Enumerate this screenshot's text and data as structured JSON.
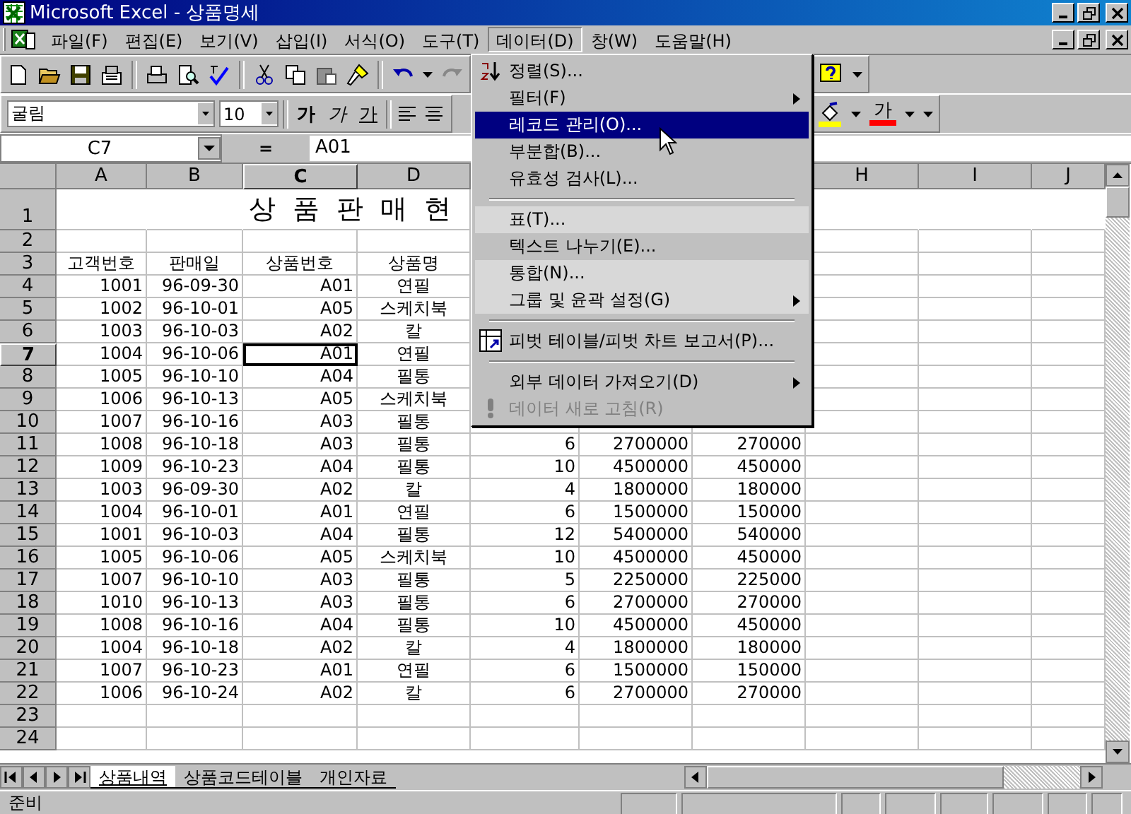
{
  "window": {
    "title": "Microsoft Excel - 상품명세"
  },
  "menu_bar": [
    {
      "label": "파일(F)",
      "selected": false
    },
    {
      "label": "편집(E)",
      "selected": false
    },
    {
      "label": "보기(V)",
      "selected": false
    },
    {
      "label": "삽입(I)",
      "selected": false
    },
    {
      "label": "서식(O)",
      "selected": false
    },
    {
      "label": "도구(T)",
      "selected": false
    },
    {
      "label": "데이터(D)",
      "selected": true
    },
    {
      "label": "창(W)",
      "selected": false
    },
    {
      "label": "도움말(H)",
      "selected": false
    }
  ],
  "formatting": {
    "font": "굴림",
    "size": "10",
    "bold": "가",
    "italic": "가",
    "underline": "가",
    "font_color": "가"
  },
  "formula_bar": {
    "name_box": "C7",
    "equals": "=",
    "content": "A01"
  },
  "data_menu": [
    {
      "kind": "sort",
      "label": "정렬(S)...",
      "submenu": false,
      "selected": false,
      "disabled": false,
      "rarely_used": false
    },
    {
      "kind": "item",
      "label": "필터(F)",
      "submenu": true,
      "selected": false,
      "disabled": false,
      "rarely_used": false
    },
    {
      "kind": "item",
      "label": "레코드 관리(O)...",
      "submenu": false,
      "selected": true,
      "disabled": false,
      "rarely_used": false
    },
    {
      "kind": "item",
      "label": "부분합(B)...",
      "submenu": false,
      "selected": false,
      "disabled": false,
      "rarely_used": false
    },
    {
      "kind": "item",
      "label": "유효성 검사(L)...",
      "submenu": false,
      "selected": false,
      "disabled": false,
      "rarely_used": false
    },
    {
      "kind": "separator"
    },
    {
      "kind": "item",
      "label": "표(T)...",
      "submenu": false,
      "selected": false,
      "disabled": false,
      "rarely_used": true
    },
    {
      "kind": "item",
      "label": "텍스트 나누기(E)...",
      "submenu": false,
      "selected": false,
      "disabled": false,
      "rarely_used": false
    },
    {
      "kind": "item",
      "label": "통합(N)...",
      "submenu": false,
      "selected": false,
      "disabled": false,
      "rarely_used": true
    },
    {
      "kind": "item",
      "label": "그룹 및 윤곽 설정(G)",
      "submenu": true,
      "selected": false,
      "disabled": false,
      "rarely_used": true
    },
    {
      "kind": "separator"
    },
    {
      "kind": "pivot",
      "label": "피벗 테이블/피벗 차트 보고서(P)...",
      "submenu": false,
      "selected": false,
      "disabled": false,
      "rarely_used": false
    },
    {
      "kind": "separator"
    },
    {
      "kind": "item",
      "label": "외부 데이터 가져오기(D)",
      "submenu": true,
      "selected": false,
      "disabled": false,
      "rarely_used": false
    },
    {
      "kind": "refresh",
      "label": "데이터 새로 고침(R)",
      "submenu": false,
      "selected": false,
      "disabled": true,
      "rarely_used": false
    }
  ],
  "sheet": {
    "columns": [
      {
        "label": "A",
        "selected": false
      },
      {
        "label": "B",
        "selected": false
      },
      {
        "label": "C",
        "selected": true
      },
      {
        "label": "D",
        "selected": false
      },
      null,
      null,
      null,
      {
        "label": "H",
        "selected": false
      },
      {
        "label": "I",
        "selected": false
      },
      {
        "label": "J",
        "selected": false
      }
    ],
    "rows": [
      {
        "header": "1",
        "kind": "title",
        "selected": false,
        "cells": [
          null,
          null,
          "상 품 판 매 현"
        ]
      },
      {
        "header": "2",
        "kind": "data",
        "selected": false,
        "cells": []
      },
      {
        "header": "3",
        "kind": "header",
        "selected": false,
        "cells": [
          "고객번호",
          "판매일",
          "상품번호",
          "상품명"
        ]
      },
      {
        "header": "4",
        "kind": "data",
        "selected": false,
        "cells": [
          "1001",
          "96-09-30",
          "A01",
          "연필"
        ]
      },
      {
        "header": "5",
        "kind": "data",
        "selected": false,
        "cells": [
          "1002",
          "96-10-01",
          "A05",
          "스케치북"
        ]
      },
      {
        "header": "6",
        "kind": "data",
        "selected": false,
        "cells": [
          "1003",
          "96-10-03",
          "A02",
          "칼"
        ]
      },
      {
        "header": "7",
        "kind": "data",
        "selected": true,
        "cells": [
          "1004",
          "96-10-06",
          "A01",
          "연필"
        ]
      },
      {
        "header": "8",
        "kind": "data",
        "selected": false,
        "cells": [
          "1005",
          "96-10-10",
          "A04",
          "필통"
        ]
      },
      {
        "header": "9",
        "kind": "data",
        "selected": false,
        "cells": [
          "1006",
          "96-10-13",
          "A05",
          "스케치북"
        ]
      },
      {
        "header": "10",
        "kind": "data",
        "selected": false,
        "cells": [
          "1007",
          "96-10-16",
          "A03",
          "필통"
        ]
      },
      {
        "header": "11",
        "kind": "data",
        "selected": false,
        "cells": [
          "1008",
          "96-10-18",
          "A03",
          "필통",
          "6",
          "2700000",
          "270000"
        ]
      },
      {
        "header": "12",
        "kind": "data",
        "selected": false,
        "cells": [
          "1009",
          "96-10-23",
          "A04",
          "필통",
          "10",
          "4500000",
          "450000"
        ]
      },
      {
        "header": "13",
        "kind": "data",
        "selected": false,
        "cells": [
          "1003",
          "96-09-30",
          "A02",
          "칼",
          "4",
          "1800000",
          "180000"
        ]
      },
      {
        "header": "14",
        "kind": "data",
        "selected": false,
        "cells": [
          "1004",
          "96-10-01",
          "A01",
          "연필",
          "6",
          "1500000",
          "150000"
        ]
      },
      {
        "header": "15",
        "kind": "data",
        "selected": false,
        "cells": [
          "1001",
          "96-10-03",
          "A04",
          "필통",
          "12",
          "5400000",
          "540000"
        ]
      },
      {
        "header": "16",
        "kind": "data",
        "selected": false,
        "cells": [
          "1005",
          "96-10-06",
          "A05",
          "스케치북",
          "10",
          "4500000",
          "450000"
        ]
      },
      {
        "header": "17",
        "kind": "data",
        "selected": false,
        "cells": [
          "1007",
          "96-10-10",
          "A03",
          "필통",
          "5",
          "2250000",
          "225000"
        ]
      },
      {
        "header": "18",
        "kind": "data",
        "selected": false,
        "cells": [
          "1010",
          "96-10-13",
          "A03",
          "필통",
          "6",
          "2700000",
          "270000"
        ]
      },
      {
        "header": "19",
        "kind": "data",
        "selected": false,
        "cells": [
          "1008",
          "96-10-16",
          "A04",
          "필통",
          "10",
          "4500000",
          "450000"
        ]
      },
      {
        "header": "20",
        "kind": "data",
        "selected": false,
        "cells": [
          "1004",
          "96-10-18",
          "A02",
          "칼",
          "4",
          "1800000",
          "180000"
        ]
      },
      {
        "header": "21",
        "kind": "data",
        "selected": false,
        "cells": [
          "1007",
          "96-10-23",
          "A01",
          "연필",
          "6",
          "1500000",
          "150000"
        ]
      },
      {
        "header": "22",
        "kind": "data",
        "selected": false,
        "cells": [
          "1006",
          "96-10-24",
          "A02",
          "칼",
          "6",
          "2700000",
          "270000"
        ]
      },
      {
        "header": "23",
        "kind": "data",
        "selected": false,
        "cells": []
      },
      {
        "header": "24",
        "kind": "data",
        "selected": false,
        "cells": []
      }
    ]
  },
  "sheet_tabs": [
    {
      "label": "상품내역",
      "selected": true
    },
    {
      "label": "상품코드테이블",
      "selected": false
    },
    {
      "label": "개인자료",
      "selected": false
    }
  ],
  "status_bar": {
    "text": "준비"
  }
}
